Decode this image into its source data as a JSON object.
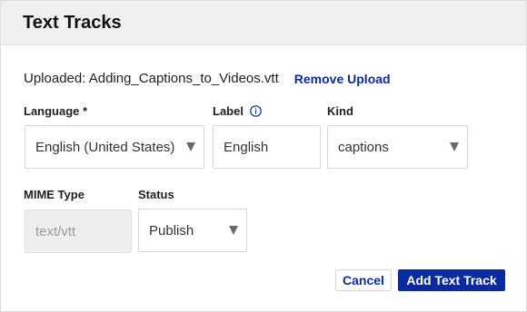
{
  "dialog": {
    "title": "Text Tracks"
  },
  "upload": {
    "text": "Uploaded: Adding_Captions_to_Videos.vtt",
    "remove_label": "Remove Upload"
  },
  "language": {
    "label": "Language *",
    "value": "English (United States)"
  },
  "label_field": {
    "label": "Label",
    "value": "English",
    "info_icon": "info-circle"
  },
  "kind": {
    "label": "Kind",
    "value": "captions"
  },
  "mime": {
    "label": "MIME Type",
    "value": "text/vtt"
  },
  "status": {
    "label": "Status",
    "value": "Publish"
  },
  "actions": {
    "cancel_label": "Cancel",
    "add_label": "Add Text Track"
  },
  "colors": {
    "accent": "#0b2a9e",
    "header_bg": "#efefef",
    "disabled_bg": "#eeeeee"
  }
}
